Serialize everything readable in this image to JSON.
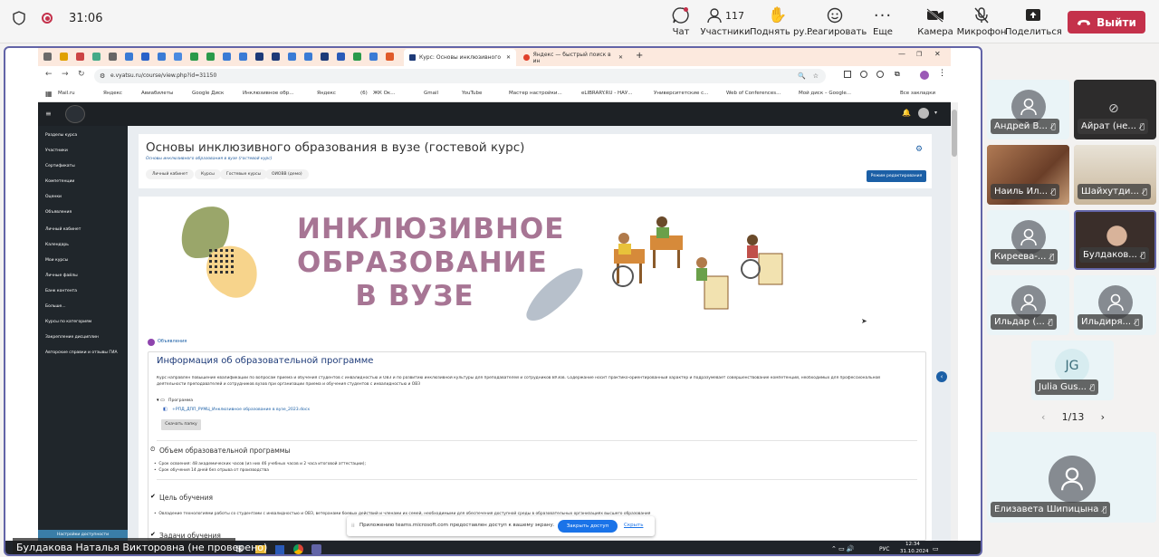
{
  "meeting": {
    "timer": "31:06",
    "toolbar": {
      "chat": "Чат",
      "participants": "Участники",
      "participants_count": "117",
      "raise_hand": "Поднять ру...",
      "react": "Реагировать",
      "more": "Еще",
      "camera": "Камера",
      "mic": "Микрофон",
      "share": "Поделиться",
      "leave": "Выйти"
    },
    "presenter": "Булдакова Наталья Викторовна (не проверено)",
    "participants_tiles": [
      {
        "name": "Андрей В...",
        "avatar": "person-icon"
      },
      {
        "name": "Айрат (не...",
        "avatar": "camera-off-icon"
      },
      {
        "name": "Наиль Ил...",
        "avatar": "video"
      },
      {
        "name": "Шайхутди...",
        "avatar": "video"
      },
      {
        "name": "Киреева-...",
        "avatar": "person-icon"
      },
      {
        "name": "Булдаков...",
        "avatar": "video"
      },
      {
        "name": "Ильдар (...",
        "avatar": "person-icon"
      },
      {
        "name": "Ильдиря...",
        "avatar": "person-icon"
      },
      {
        "name": "Julia Gus...",
        "avatar": "JG"
      },
      {
        "name": "Елизавета Шипицына",
        "avatar": "person-icon"
      }
    ],
    "page_indicator": "1/13"
  },
  "browser": {
    "tabs": [
      {
        "label": "Курс: Основы инклюзивного"
      },
      {
        "label": "Яндекс — быстрый поиск в ин"
      }
    ],
    "url": "e.vyatsu.ru/course/view.php?id=31150",
    "bookmarks": [
      "Mail.ru",
      "Яндекс",
      "Авиабилеты",
      "Google Диск",
      "Инклюзивное обр...",
      "Яндекс",
      "(6)",
      "ЖК Ок...",
      "Gmail",
      "YouTube",
      "Мастер настройки...",
      "eLIBRARY.RU - НАУ...",
      "Университетские с...",
      "Web of Conferences...",
      "Мой диск – Google...",
      "Все закладки"
    ]
  },
  "moodle": {
    "sidebar": [
      "Разделы курса",
      "Участники",
      "Сертификаты",
      "Компетенции",
      "Оценки",
      "Объявления",
      "Личный кабинет",
      "Календарь",
      "Мои курсы",
      "Личные файлы",
      "Банк контента",
      "Больше...",
      "Курсы по категориям",
      "Закрепление дисциплин",
      "Авторские справки и отзывы ГИА"
    ],
    "sidebar_bottom": "Настройки доступности",
    "course_title": "Основы инклюзивного образования в вузе (гостевой курс)",
    "course_subtitle": "Основы инклюзивного образования в вузе (гостевой курс)",
    "breadcrumbs": [
      "Личный кабинет",
      "Курсы",
      "Гостевые курсы",
      "ОИОВВ (демо)"
    ],
    "edit_mode": "Режим редактирования",
    "banner_lines": [
      "ИНКЛЮЗИВНОЕ",
      "ОБРАЗОВАНИЕ",
      "В ВУЗЕ"
    ],
    "announcements": "Объявления",
    "info_title": "Информация об образовательной программе",
    "info_text_1": "Курс направлен повышение квалификации по вопросам приема и обучения студентов с инвалидностью и ОВЗ и по развитию инклюзивной культуры для преподавателей и сотрудников ВУЗов. Содержание носит практико-ориентированный характер и подразумевает совершенствование компетенций, необходимых для профессиональной",
    "info_text_2": "деятельности преподавателей и сотрудников вузов при организации приема и обучения студентов с инвалидностью и ОВЗ",
    "program_label": "Программа",
    "program_file": "+РПД_ДПП_РУМЦ_Инклюзивное образование в вузе_2023.docx",
    "download_folder": "Скачать папку",
    "volume_title": "Объем образовательной программы",
    "volume_items": [
      "Срок освоения: 48 академических часов (из них 46 учебных часов и 2 часа итоговой аттестации);",
      "Срок обучения 14 дней без отрыва от производства"
    ],
    "goal_title": "Цель обучения",
    "goal_item": "Овладение технологиями работы со студентами с инвалидностью и ОВЗ, ветеранами боевых действий и членами их семей, необходимыми для обеспечения доступной среды в образовательных организациях высшего образования",
    "tasks_title": "Задачи обучения"
  },
  "notice": {
    "text": "Приложению teams.microsoft.com предоставлен доступ к вашему экрану.",
    "stop": "Закрыть доступ",
    "hide": "Скрыть"
  },
  "taskbar": {
    "lang": "РУС",
    "time": "12:34",
    "date": "31.10.2024"
  },
  "colors": {
    "leave": "#c4314b",
    "teams_accent": "#6264a7",
    "banner_text": "#a77594",
    "moodle_sidebar": "#20262b"
  }
}
